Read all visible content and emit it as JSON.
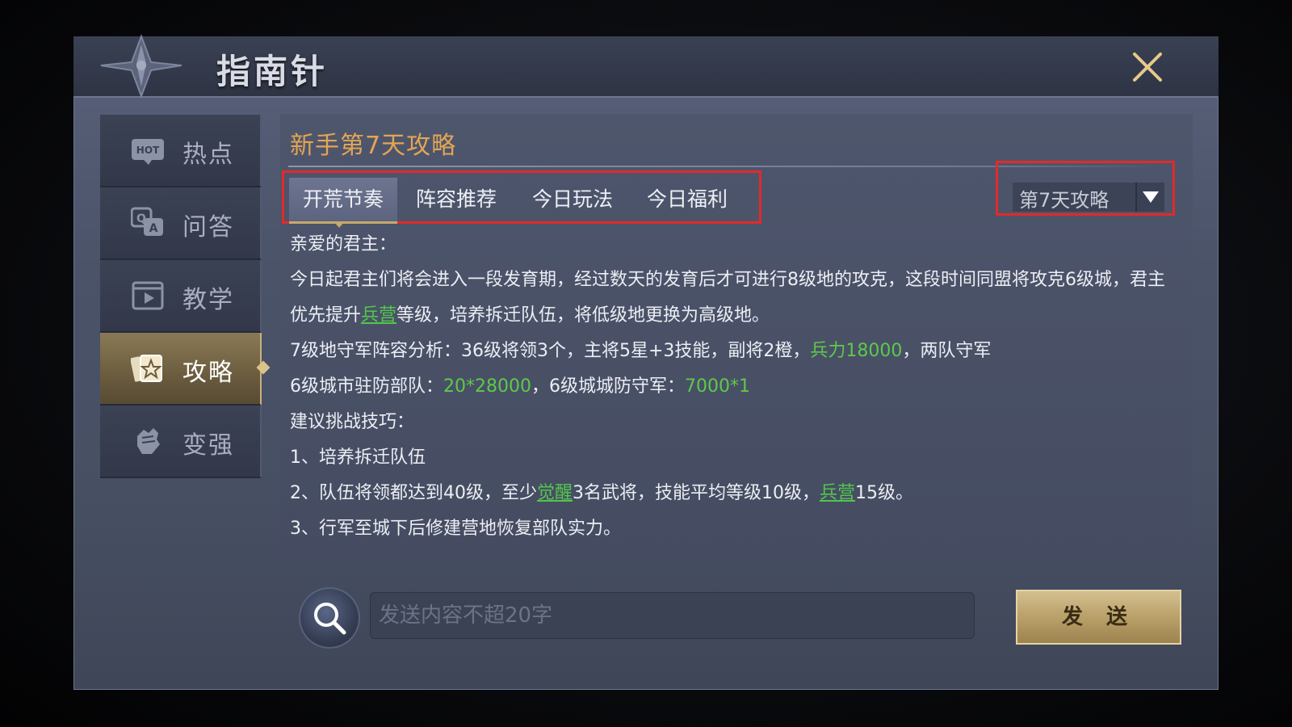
{
  "window": {
    "title": "指南针"
  },
  "sidebar": {
    "items": [
      {
        "label": "热点",
        "icon": "hot-icon",
        "active": false
      },
      {
        "label": "问答",
        "icon": "qa-icon",
        "active": false
      },
      {
        "label": "教学",
        "icon": "video-icon",
        "active": false
      },
      {
        "label": "攻略",
        "icon": "star-card-icon",
        "active": true
      },
      {
        "label": "变强",
        "icon": "fist-icon",
        "active": false
      }
    ]
  },
  "content": {
    "title": "新手第7天攻略",
    "tabs": [
      {
        "label": "开荒节奏",
        "active": true
      },
      {
        "label": "阵容推荐",
        "active": false
      },
      {
        "label": "今日玩法",
        "active": false
      },
      {
        "label": "今日福利",
        "active": false
      }
    ],
    "dropdown": {
      "value": "第7天攻略"
    },
    "body": {
      "greeting": "亲爱的君主：",
      "p1a": "今日起君主们将会进入一段发育期，经过数天的发育后才可进行8级地的攻克，这段时间同盟将攻克6级城，君主优先提升",
      "p1_link": "兵营",
      "p1b": "等级，培养拆迁队伍，将低级地更换为高级地。",
      "p2a": "7级地守军阵容分析：36级将领3个，主将5星+3技能，副将2橙，",
      "p2_hl": "兵力18000",
      "p2b": "，两队守军",
      "p3a": "6级城市驻防部队：",
      "p3_hl1": "20*28000",
      "p3b": "，6级城城防守军：",
      "p3_hl2": "7000*1",
      "tips_title": "建议挑战技巧：",
      "tip1": "1、培养拆迁队伍",
      "tip2a": "2、队伍将领都达到40级，至少",
      "tip2_link1": "觉醒",
      "tip2b": "3名武将，技能平均等级10级，",
      "tip2_link2": "兵营",
      "tip2c": "15级。",
      "tip3": "3、行军至城下后修建营地恢复部队实力。"
    }
  },
  "footer": {
    "input_placeholder": "发送内容不超20字",
    "send_label": "发 送"
  },
  "colors": {
    "title_accent": "#e3a553",
    "highlight_green": "#5ec94a",
    "annotation_red": "#e22a2a"
  }
}
